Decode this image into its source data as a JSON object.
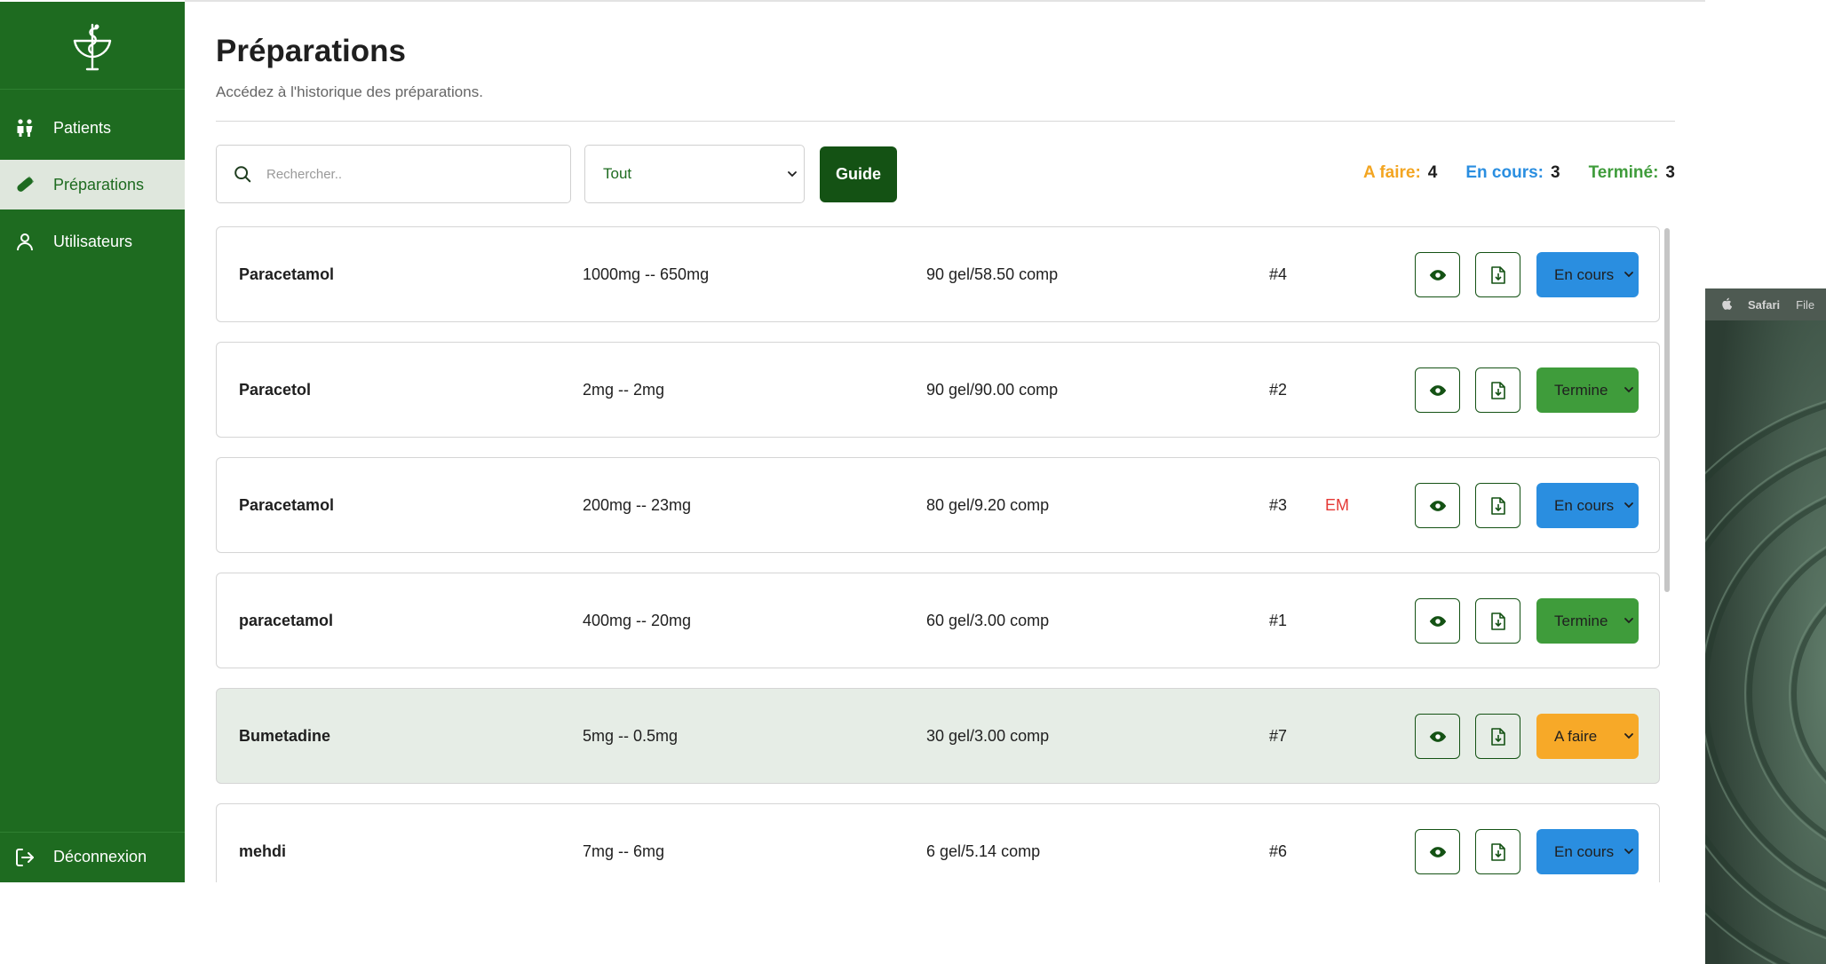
{
  "sidebar": {
    "logo": "pharmacy-caduceus-logo",
    "items": [
      {
        "label": "Patients",
        "icon": "people-icon"
      },
      {
        "label": "Préparations",
        "icon": "pill-icon"
      },
      {
        "label": "Utilisateurs",
        "icon": "user-icon"
      }
    ],
    "logout": {
      "label": "Déconnexion",
      "icon": "logout-icon"
    }
  },
  "header": {
    "title": "Préparations",
    "subtitle": "Accédez à l'historique des préparations."
  },
  "toolbar": {
    "search_placeholder": "Rechercher..",
    "filter_value": "Tout",
    "guide_label": "Guide"
  },
  "counts": [
    {
      "label": "A faire:",
      "value": "4",
      "color": "#f3a521"
    },
    {
      "label": "En cours:",
      "value": "3",
      "color": "#2a8ee0"
    },
    {
      "label": "Terminé:",
      "value": "3",
      "color": "#3f9c3b"
    }
  ],
  "rows": [
    {
      "name": "Paracetamol",
      "dose": "1000mg -- 650mg",
      "qty": "90 gel/58.50 comp",
      "num": "#4",
      "tag": "",
      "status": "En cours"
    },
    {
      "name": "Paracetol",
      "dose": "2mg -- 2mg",
      "qty": "90 gel/90.00 comp",
      "num": "#2",
      "tag": "",
      "status": "Termine"
    },
    {
      "name": "Paracetamol",
      "dose": "200mg -- 23mg",
      "qty": "80 gel/9.20 comp",
      "num": "#3",
      "tag": "EM",
      "status": "En cours"
    },
    {
      "name": "paracetamol",
      "dose": "400mg -- 20mg",
      "qty": "60 gel/3.00 comp",
      "num": "#1",
      "tag": "",
      "status": "Termine"
    },
    {
      "name": "Bumetadine",
      "dose": "5mg -- 0.5mg",
      "qty": "30 gel/3.00 comp",
      "num": "#7",
      "tag": "",
      "status": "A faire"
    },
    {
      "name": "mehdi",
      "dose": "7mg -- 6mg",
      "qty": "6 gel/5.14 comp",
      "num": "#6",
      "tag": "",
      "status": "En cours"
    }
  ],
  "status_colors": {
    "En cours": "#2a8ee0",
    "Termine": "#3f9c3b",
    "A faire": "#f7a928"
  },
  "desktop": {
    "menubar": {
      "app": "Safari",
      "menu": "File"
    }
  }
}
